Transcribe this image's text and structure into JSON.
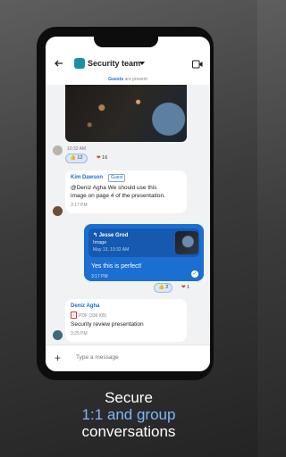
{
  "header": {
    "title": "Security team",
    "guests_bold": "Guests",
    "guests_rest": " are present"
  },
  "messages": {
    "image_msg": {
      "time": "10:32 AM",
      "reaction_like_count": "12",
      "reaction_heart_count": "16"
    },
    "kim": {
      "sender": "Kim Dawson",
      "badge": "Guest",
      "text_line1": "@Deniz Agha We should use this",
      "text_line2": "image on page 4 of the presentation.",
      "time": "3:17 PM"
    },
    "outgoing": {
      "quote_name": "Jesse Grod",
      "quote_sub": "Image",
      "quote_date": "May 13, 10:32 AM",
      "text": "Yes this is perfect!",
      "time": "3:17 PM",
      "reaction_like_count": "2",
      "reaction_heart_count": "1"
    },
    "deniz": {
      "sender": "Deniz Agha",
      "file_meta": "PDF (336 KB)",
      "file_name": "Security review presentation",
      "time": "3:25 PM"
    }
  },
  "composer": {
    "placeholder": "Type a message"
  },
  "caption": {
    "line1": "Secure",
    "line2": "1:1 and group",
    "line3": "conversations"
  },
  "colors": {
    "accent": "#1a6fd1",
    "caption_accent": "#7fb6ff",
    "team_avatar": "#1a8fa8"
  },
  "icons": [
    "back-arrow-icon",
    "video-call-icon",
    "caret-down-icon",
    "thumbs-up-icon",
    "heart-icon",
    "reply-icon",
    "pdf-icon",
    "check-icon",
    "plus-icon"
  ]
}
